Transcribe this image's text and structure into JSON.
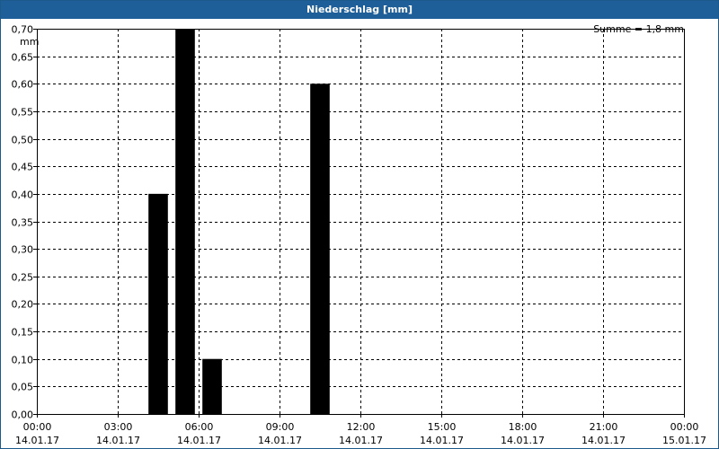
{
  "window": {
    "title": "Niederschlag [mm]"
  },
  "chart_data": {
    "type": "bar",
    "title": "Niederschlag [mm]",
    "unit": "mm",
    "summary": "Summe = 1,8 mm",
    "xlim": [
      "14.01.17 00:00",
      "15.01.17 00:00"
    ],
    "ylim": [
      0,
      0.7
    ],
    "y_ticks": [
      "0,00",
      "0,05",
      "0,10",
      "0,15",
      "0,20",
      "0,25",
      "0,30",
      "0,35",
      "0,40",
      "0,45",
      "0,50",
      "0,55",
      "0,60",
      "0,65",
      "0,70"
    ],
    "x_ticks": [
      {
        "time": "00:00",
        "date": "14.01.17"
      },
      {
        "time": "03:00",
        "date": "14.01.17"
      },
      {
        "time": "06:00",
        "date": "14.01.17"
      },
      {
        "time": "09:00",
        "date": "14.01.17"
      },
      {
        "time": "12:00",
        "date": "14.01.17"
      },
      {
        "time": "15:00",
        "date": "14.01.17"
      },
      {
        "time": "18:00",
        "date": "14.01.17"
      },
      {
        "time": "21:00",
        "date": "14.01.17"
      },
      {
        "time": "00:00",
        "date": "15.01.17"
      }
    ],
    "bars": [
      {
        "start": "14.01.17 04:00",
        "end": "14.01.17 05:00",
        "value": 0.4
      },
      {
        "start": "14.01.17 05:00",
        "end": "14.01.17 06:00",
        "value": 0.7
      },
      {
        "start": "14.01.17 06:00",
        "end": "14.01.17 07:00",
        "value": 0.1
      },
      {
        "start": "14.01.17 10:00",
        "end": "14.01.17 11:00",
        "value": 0.6
      }
    ],
    "grid": true,
    "colors": {
      "bar": "#000000",
      "title_bar": "#1e5f99",
      "grid": "#000000"
    }
  }
}
